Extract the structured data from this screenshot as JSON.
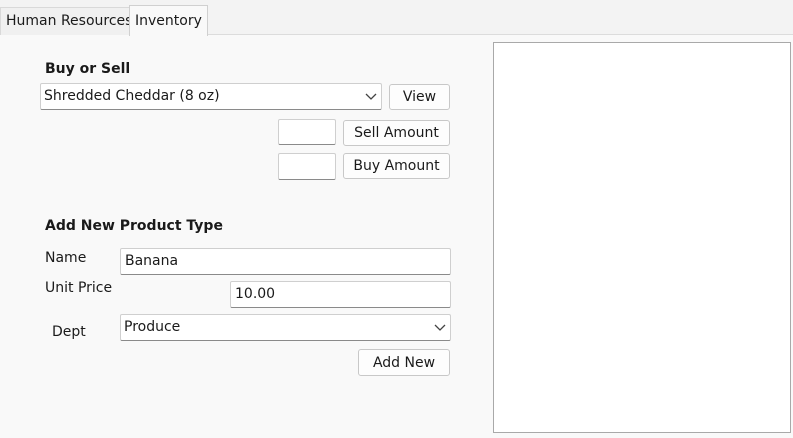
{
  "tabs": [
    {
      "label": "Human Resources",
      "active": false
    },
    {
      "label": "Inventory",
      "active": true
    }
  ],
  "buy_sell": {
    "heading": "Buy or Sell",
    "product_select": {
      "value": "Shredded Cheddar (8 oz)"
    },
    "view_label": "View",
    "sell_amount_value": "",
    "sell_amount_label": "Sell Amount",
    "buy_amount_value": "",
    "buy_amount_label": "Buy Amount"
  },
  "add_product": {
    "heading": "Add New Product Type",
    "name_label": "Name",
    "name_value": "Banana",
    "unit_price_label": "Unit Price",
    "unit_price_value": "10.00",
    "dept_label": "Dept",
    "dept_select": {
      "value": "Produce"
    },
    "add_new_label": "Add New"
  },
  "icons": {
    "dropdown": "chevron-down-icon"
  },
  "colors": {
    "background": "#f9f9f9",
    "panel": "#ffffff",
    "border": "#a9a9a9"
  }
}
